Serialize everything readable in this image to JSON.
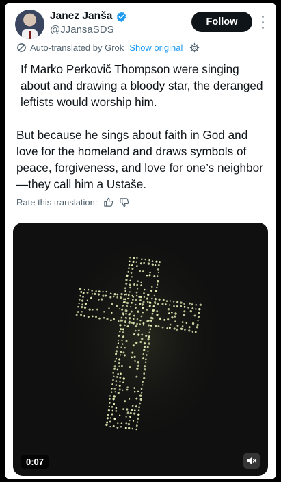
{
  "author": {
    "name": "Janez Janša",
    "handle": "@JJansaSDS",
    "verified": true,
    "avatar": "avatar-photo"
  },
  "header": {
    "follow_label": "Follow",
    "more_icon": "more-dots-icon"
  },
  "translation": {
    "notice": "Auto-translated by Grok",
    "show_original": "Show original",
    "icons": [
      "grok-icon",
      "gear-icon"
    ]
  },
  "post": {
    "paragraph_1": "If Marko Perkovič Thompson were singing about and drawing a bloody star, the deranged leftists would worship him.",
    "paragraph_2": "But because he sings about faith in God and love for the homeland and draws symbols of peace, forgiveness, and love for one’s neighbor—they call him a Ustaše."
  },
  "rating": {
    "label": "Rate this translation:",
    "icons": [
      "thumbs-up-icon",
      "thumbs-down-icon"
    ]
  },
  "media": {
    "type": "video",
    "timestamp": "0:07",
    "mute_icon": "muted-speaker-icon",
    "colors": {
      "background": "#101010",
      "dots": "#e9efb8"
    }
  },
  "colors": {
    "accent": "#1d9bf0",
    "text": "#0f1419",
    "secondary": "#536471",
    "follow_bg": "#0f1419"
  }
}
